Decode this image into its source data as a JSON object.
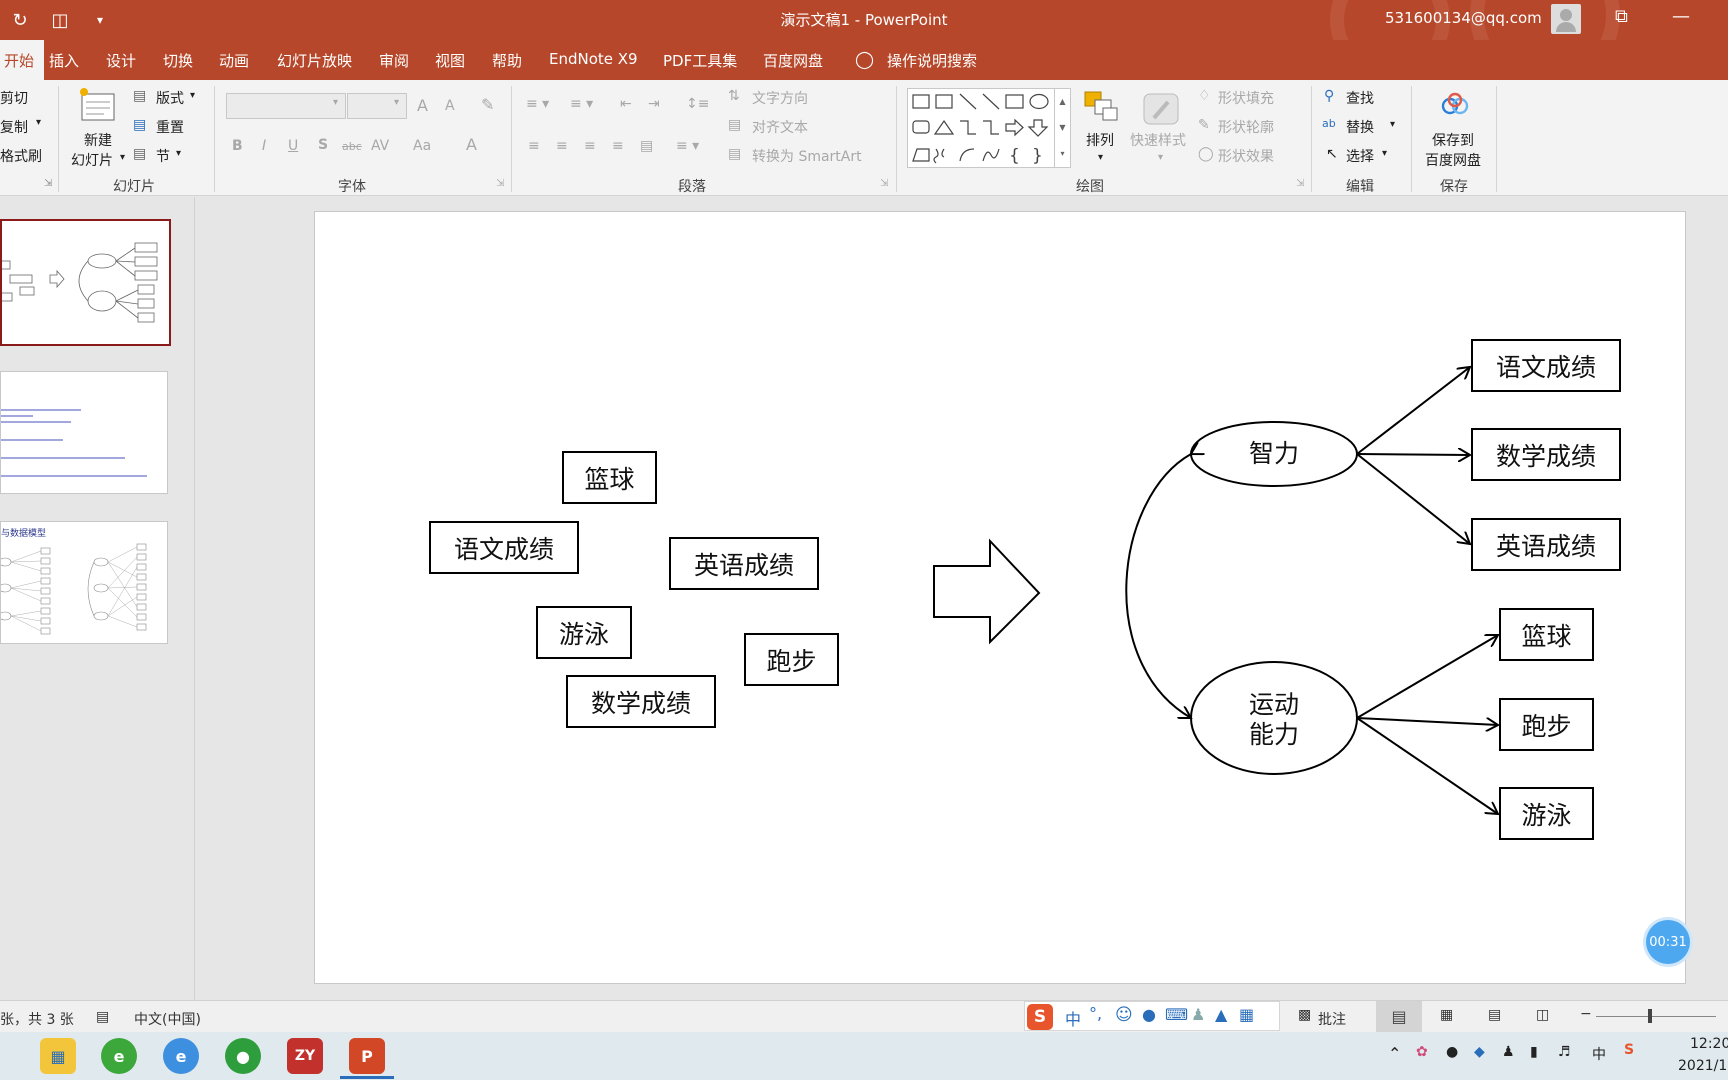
{
  "titlebar": {
    "doc_title": "演示文稿1  -  PowerPoint",
    "account": "531600134@qq.com",
    "minimize": "—",
    "restore": "⧉"
  },
  "tabs": [
    {
      "label": "开始",
      "active": true
    },
    {
      "label": "插入"
    },
    {
      "label": "设计"
    },
    {
      "label": "切换"
    },
    {
      "label": "动画"
    },
    {
      "label": "幻灯片放映"
    },
    {
      "label": "审阅"
    },
    {
      "label": "视图"
    },
    {
      "label": "帮助"
    },
    {
      "label": "EndNote X9"
    },
    {
      "label": "PDF工具集"
    },
    {
      "label": "百度网盘"
    },
    {
      "label": "操作说明搜索"
    }
  ],
  "ribbon": {
    "clipboard": {
      "cut": "剪切",
      "copy": "复制",
      "format_painter": "格式刷"
    },
    "slides": {
      "new_slide_1": "新建",
      "new_slide_2": "幻灯片",
      "layout": "版式",
      "reset": "重置",
      "section": "节",
      "label": "幻灯片"
    },
    "font": {
      "label": "字体",
      "bold": "B",
      "italic": "I",
      "underline": "U",
      "shadow": "S",
      "strike": "abc",
      "spacing": "AV",
      "case": "Aa",
      "color": "A",
      "grow": "A",
      "shrink": "A"
    },
    "paragraph": {
      "label": "段落",
      "text_direction": "文字方向",
      "align_text": "对齐文本",
      "smartart": "转换为 SmartArt"
    },
    "drawing": {
      "label": "绘图",
      "arrange": "排列",
      "quick_styles": "快速样式",
      "shape_fill": "形状填充",
      "shape_outline": "形状轮廓",
      "shape_effects": "形状效果"
    },
    "editing": {
      "label": "编辑",
      "find": "查找",
      "replace": "替换",
      "select": "选择"
    },
    "save": {
      "label": "保存",
      "save_to_1": "保存到",
      "save_to_2": "百度网盘"
    }
  },
  "slide": {
    "left_boxes": [
      "篮球",
      "语文成绩",
      "英语成绩",
      "游泳",
      "跑步",
      "数学成绩"
    ],
    "factor1": "智力",
    "factor2_line1": "运动",
    "factor2_line2": "能力",
    "right_boxes": [
      "语文成绩",
      "数学成绩",
      "英语成绩",
      "篮球",
      "跑步",
      "游泳"
    ]
  },
  "thumbnails": {
    "t3_title": "与数据模型"
  },
  "timer": "00:31",
  "statusbar": {
    "slide_count": "张，共 3 张",
    "language": "中文(中国)",
    "comments": "批注",
    "ime": "中"
  },
  "taskbar": {
    "time": "12:20",
    "date": "2021/1",
    "ime_lang": "中"
  },
  "colors": {
    "accent": "#b7472a",
    "ribbon_bg": "#f3f3f3",
    "thumb_active_border": "#8b1a1a"
  }
}
